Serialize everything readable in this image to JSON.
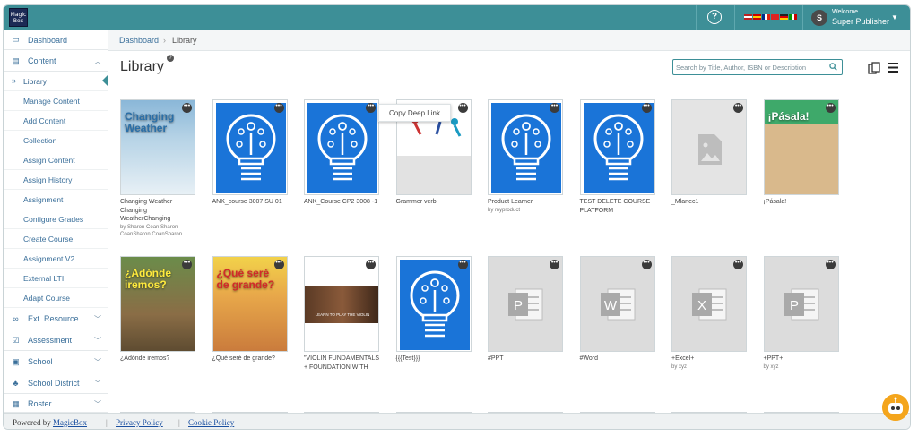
{
  "app": {
    "logo_text": "MagicBox",
    "welcome": "Welcome",
    "user_name": "Super Publisher",
    "avatar_initial": "S",
    "help_label": "?"
  },
  "sidebar": {
    "dashboard": "Dashboard",
    "content": "Content",
    "content_items": [
      "Library",
      "Manage Content",
      "Add Content",
      "Collection",
      "Assign Content",
      "Assign History",
      "Assignment",
      "Configure Grades",
      "Create Course",
      "Assignment V2",
      "External LTI",
      "Adapt Course"
    ],
    "sections": [
      "Ext. Resource",
      "Assessment",
      "School",
      "School District",
      "Roster"
    ]
  },
  "breadcrumb": {
    "home": "Dashboard",
    "separator": "›",
    "current": "Library"
  },
  "page": {
    "title": "Library",
    "title_badge": "?"
  },
  "search": {
    "placeholder": "Search by Title, Author, ISBN or Description"
  },
  "tooltip": {
    "label": "Copy Deep Link"
  },
  "row1": [
    {
      "title": "Changing Weather Changing WeatherChanging",
      "by": "by Sharon Coan Sharon CoanSharon CoanSharon",
      "thumb": "book-weather",
      "cover_title": "Changing Weather"
    },
    {
      "title": "ANK_course 3007 SU 01",
      "by": "",
      "thumb": "course-blue"
    },
    {
      "title": "ANK_Course CP2 3008 -1",
      "by": "",
      "thumb": "course-blue"
    },
    {
      "title": "Grammer verb",
      "by": "",
      "thumb": "grammar-image"
    },
    {
      "title": "Product Learner",
      "by": "by myproduct",
      "thumb": "course-blue"
    },
    {
      "title": "TEST DELETE COURSE PLATFORM",
      "by": "",
      "thumb": "course-blue"
    },
    {
      "title": "_Mlanec1",
      "by": "",
      "thumb": "image-placeholder"
    },
    {
      "title": "¡Pásala!",
      "by": "",
      "thumb": "book-pasala",
      "cover_title": "¡Pásala!"
    }
  ],
  "row2": [
    {
      "title": "¿Adónde iremos?",
      "by": "",
      "thumb": "book-adonde",
      "cover_title": "¿Adónde iremos?"
    },
    {
      "title": "¿Qué seré de grande?",
      "by": "",
      "thumb": "book-que",
      "cover_title": "¿Qué seré de grande?"
    },
    {
      "title": "\"VIOLIN FUNDAMENTALS + FOUNDATION WITH",
      "by": "",
      "thumb": "violin",
      "banner": "LEARN TO PLAY THE VIOLIN"
    },
    {
      "title": "{{{Test}}}",
      "by": "",
      "thumb": "course-blue"
    },
    {
      "title": "#PPT",
      "by": "",
      "thumb": "ppt-file"
    },
    {
      "title": "#Word",
      "by": "",
      "thumb": "word-file"
    },
    {
      "title": "+Excel+",
      "by": "by xyz",
      "thumb": "excel-file"
    },
    {
      "title": "+PPT+",
      "by": "by xyz",
      "thumb": "ppt-file"
    }
  ],
  "footer": {
    "powered_by": "Powered by",
    "brand": "MagicBox",
    "sep": "|",
    "privacy": "Privacy Policy",
    "cookie": "Cookie Policy"
  },
  "colors": {
    "topbar": "#3d8f97",
    "course_blue": "#1a74d8",
    "link": "#3a6f9a"
  }
}
